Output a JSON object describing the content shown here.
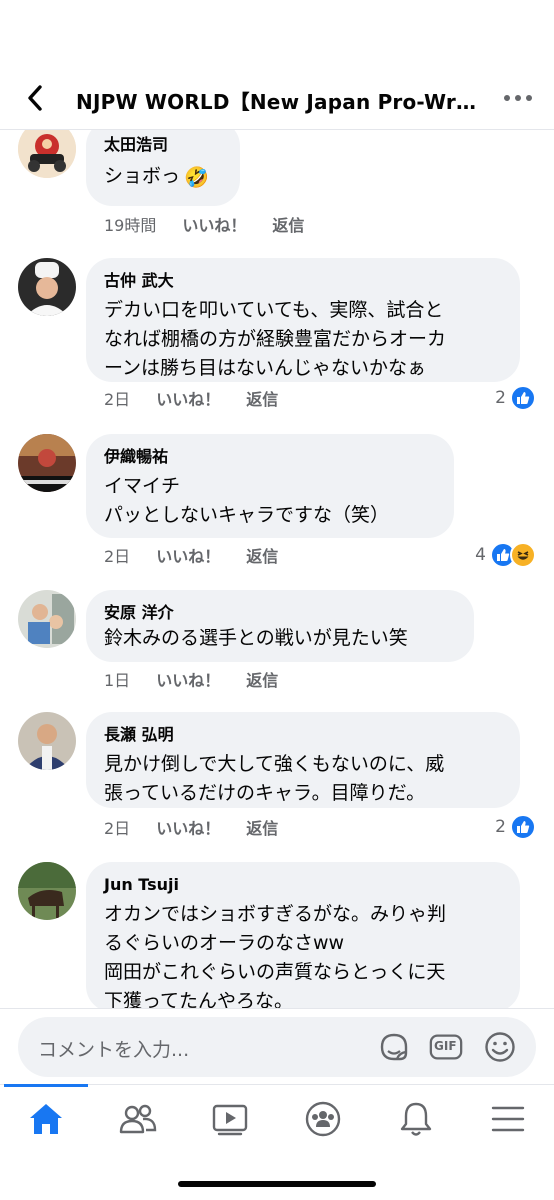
{
  "header": {
    "title": "NJPW WORLD【New Japan Pro-Wrestling】"
  },
  "comments": [
    {
      "author": "太田浩司",
      "text": "ショボっ",
      "emoji": "🤣",
      "time": "19時間",
      "like_label": "いいね！",
      "reply_label": "返信",
      "reaction_count": ""
    },
    {
      "author": "古仲 武大",
      "text": "デカい口を叩いていても、実際、試合と\nなれば棚橋の方が経験豊富だからオーカ\nーンは勝ち目はないんじゃないかなぁ",
      "time": "2日",
      "like_label": "いいね！",
      "reply_label": "返信",
      "reaction_count": "2"
    },
    {
      "author": "伊織暢祐",
      "text": "イマイチ\nパッとしないキャラですな（笑）",
      "time": "2日",
      "like_label": "いいね！",
      "reply_label": "返信",
      "reaction_count": "4"
    },
    {
      "author": "安原 洋介",
      "text": "鈴木みのる選手との戦いが見たい笑",
      "time": "1日",
      "like_label": "いいね！",
      "reply_label": "返信",
      "reaction_count": ""
    },
    {
      "author": "長瀬 弘明",
      "text": "見かけ倒しで大して強くもないのに、威\n張っているだけのキャラ。目障りだ。",
      "time": "2日",
      "like_label": "いいね！",
      "reply_label": "返信",
      "reaction_count": "2"
    },
    {
      "author": "Jun Tsuji",
      "text": "オカンではショボすぎるがな。みりゃ判\nるぐらいのオーラのなさww\n岡田がこれぐらいの声質ならとっくに天\n下獲ってたんやろな。",
      "time": "",
      "like_label": "",
      "reply_label": "",
      "reaction_count": ""
    }
  ],
  "composer": {
    "placeholder": "コメントを入力...",
    "gif_label": "GIF"
  },
  "tabs": [
    "home-tab",
    "friends-tab",
    "watch-tab",
    "groups-tab",
    "notifications-tab",
    "menu-tab"
  ],
  "colors": {
    "accent": "#1877f2",
    "bubble": "#f0f2f5",
    "secondary_text": "#65676b",
    "haha": "#f7b125"
  },
  "icons": {
    "back": "chevron-left-icon",
    "more": "more-dots-icon",
    "sticker": "sticker-icon",
    "gif": "gif-icon",
    "emoji": "emoji-icon",
    "like_reaction": "thumbs-up-icon",
    "haha_reaction": "haha-face-icon"
  }
}
